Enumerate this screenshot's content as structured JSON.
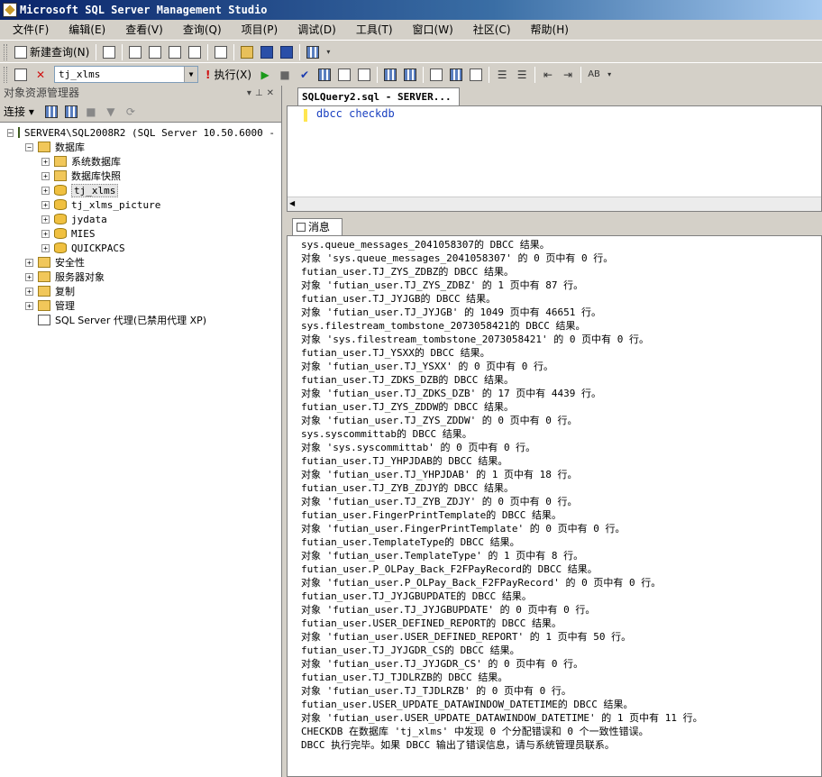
{
  "window": {
    "title": "Microsoft SQL Server Management Studio"
  },
  "menu": [
    "文件(F)",
    "编辑(E)",
    "查看(V)",
    "查询(Q)",
    "项目(P)",
    "调试(D)",
    "工具(T)",
    "窗口(W)",
    "社区(C)",
    "帮助(H)"
  ],
  "toolbar1": {
    "new_query": "新建查询(N)"
  },
  "toolbar2": {
    "database": "tj_xlms",
    "execute": "执行(X)"
  },
  "object_explorer": {
    "title": "对象资源管理器",
    "connect": "连接",
    "server": "SERVER4\\SQL2008R2 (SQL Server 10.50.6000 - S",
    "databases": "数据库",
    "system_databases": "系统数据库",
    "db_snapshots": "数据库快照",
    "dbs": [
      "tj_xlms",
      "tj_xlms_picture",
      "jydata",
      "MIES",
      "QUICKPACS"
    ],
    "security": "安全性",
    "server_objects": "服务器对象",
    "replication": "复制",
    "management": "管理",
    "agent": "SQL Server 代理(已禁用代理 XP)"
  },
  "editor": {
    "tab": "SQLQuery2.sql - SERVER...",
    "code": "dbcc checkdb"
  },
  "results": {
    "tab": "消息",
    "lines": [
      "sys.queue_messages_2041058307的 DBCC 结果。",
      "对象 'sys.queue_messages_2041058307' 的 0 页中有 0 行。",
      "futian_user.TJ_ZYS_ZDBZ的 DBCC 结果。",
      "对象 'futian_user.TJ_ZYS_ZDBZ' 的 1 页中有 87 行。",
      "futian_user.TJ_JYJGB的 DBCC 结果。",
      "对象 'futian_user.TJ_JYJGB' 的 1049 页中有 46651 行。",
      "sys.filestream_tombstone_2073058421的 DBCC 结果。",
      "对象 'sys.filestream_tombstone_2073058421' 的 0 页中有 0 行。",
      "futian_user.TJ_YSXX的 DBCC 结果。",
      "对象 'futian_user.TJ_YSXX' 的 0 页中有 0 行。",
      "futian_user.TJ_ZDKS_DZB的 DBCC 结果。",
      "对象 'futian_user.TJ_ZDKS_DZB' 的 17 页中有 4439 行。",
      "futian_user.TJ_ZYS_ZDDW的 DBCC 结果。",
      "对象 'futian_user.TJ_ZYS_ZDDW' 的 0 页中有 0 行。",
      "sys.syscommittab的 DBCC 结果。",
      "对象 'sys.syscommittab' 的 0 页中有 0 行。",
      "futian_user.TJ_YHPJDAB的 DBCC 结果。",
      "对象 'futian_user.TJ_YHPJDAB' 的 1 页中有 18 行。",
      "futian_user.TJ_ZYB_ZDJY的 DBCC 结果。",
      "对象 'futian_user.TJ_ZYB_ZDJY' 的 0 页中有 0 行。",
      "futian_user.FingerPrintTemplate的 DBCC 结果。",
      "对象 'futian_user.FingerPrintTemplate' 的 0 页中有 0 行。",
      "futian_user.TemplateType的 DBCC 结果。",
      "对象 'futian_user.TemplateType' 的 1 页中有 8 行。",
      "futian_user.P_OLPay_Back_F2FPayRecord的 DBCC 结果。",
      "对象 'futian_user.P_OLPay_Back_F2FPayRecord' 的 0 页中有 0 行。",
      "futian_user.TJ_JYJGBUPDATE的 DBCC 结果。",
      "对象 'futian_user.TJ_JYJGBUPDATE' 的 0 页中有 0 行。",
      "futian_user.USER_DEFINED_REPORT的 DBCC 结果。",
      "对象 'futian_user.USER_DEFINED_REPORT' 的 1 页中有 50 行。",
      "futian_user.TJ_JYJGDR_CS的 DBCC 结果。",
      "对象 'futian_user.TJ_JYJGDR_CS' 的 0 页中有 0 行。",
      "futian_user.TJ_TJDLRZB的 DBCC 结果。",
      "对象 'futian_user.TJ_TJDLRZB' 的 0 页中有 0 行。",
      "futian_user.USER_UPDATE_DATAWINDOW_DATETIME的 DBCC 结果。",
      "对象 'futian_user.USER_UPDATE_DATAWINDOW_DATETIME' 的 1 页中有 11 行。",
      "CHECKDB 在数据库 'tj_xlms' 中发现 0 个分配错误和 0 个一致性错误。",
      "DBCC 执行完毕。如果 DBCC 输出了错误信息，请与系统管理员联系。"
    ]
  }
}
